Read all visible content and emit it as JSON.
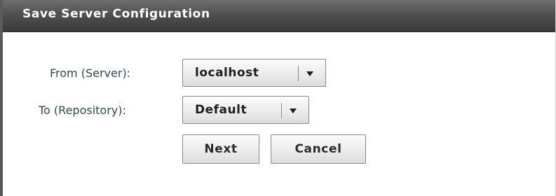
{
  "dialog": {
    "title": "Save Server Configuration"
  },
  "form": {
    "from_label": "From (Server):",
    "from_value": "localhost",
    "to_label": "To (Repository):",
    "to_value": "Default"
  },
  "buttons": {
    "next_label": "Next",
    "cancel_label": "Cancel"
  },
  "icons": {
    "dropdown": "chevron-down-icon"
  },
  "colors": {
    "titlebar": "#505050",
    "title_text": "#ffffff",
    "label_text": "#2f4a56",
    "button_text": "#2b2b2b"
  }
}
